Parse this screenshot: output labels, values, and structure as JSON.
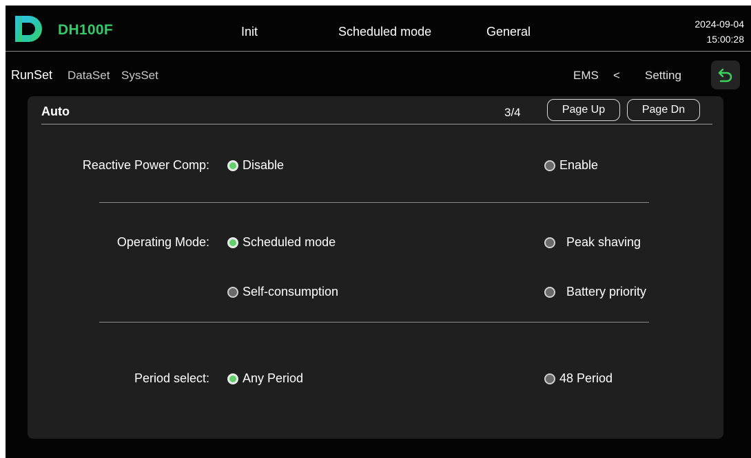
{
  "header": {
    "brand": "DH100F",
    "tabs": [
      "Init",
      "Scheduled mode",
      "General"
    ],
    "date": "2024-09-04",
    "time": "15:00:28"
  },
  "subnav": {
    "items": [
      "RunSet",
      "DataSet",
      "SysSet"
    ],
    "active": "RunSet",
    "breadcrumb": [
      "EMS",
      "<",
      "Setting"
    ]
  },
  "panel": {
    "title": "Auto",
    "page": "3/4",
    "page_up": "Page Up",
    "page_dn": "Page Dn",
    "reactive": {
      "label": "Reactive Power Comp:",
      "options": [
        {
          "label": "Disable",
          "selected": true
        },
        {
          "label": "Enable",
          "selected": false
        }
      ]
    },
    "operating": {
      "label": "Operating Mode:",
      "options": [
        {
          "label": "Scheduled mode",
          "selected": true
        },
        {
          "label": "Peak shaving",
          "selected": false
        },
        {
          "label": "Self-consumption",
          "selected": false
        },
        {
          "label": "Battery priority",
          "selected": false
        }
      ]
    },
    "period": {
      "label": "Period select:",
      "options": [
        {
          "label": "Any Period",
          "selected": true
        },
        {
          "label": "48 Period",
          "selected": false
        }
      ]
    }
  },
  "colors": {
    "accent_green": "#35c96a",
    "radio_selected": "#5ed16a",
    "background": "#040404",
    "panel": "#1f1f1f"
  },
  "icons": {
    "logo": "logo-d-icon",
    "back": "back-arrow-icon"
  }
}
